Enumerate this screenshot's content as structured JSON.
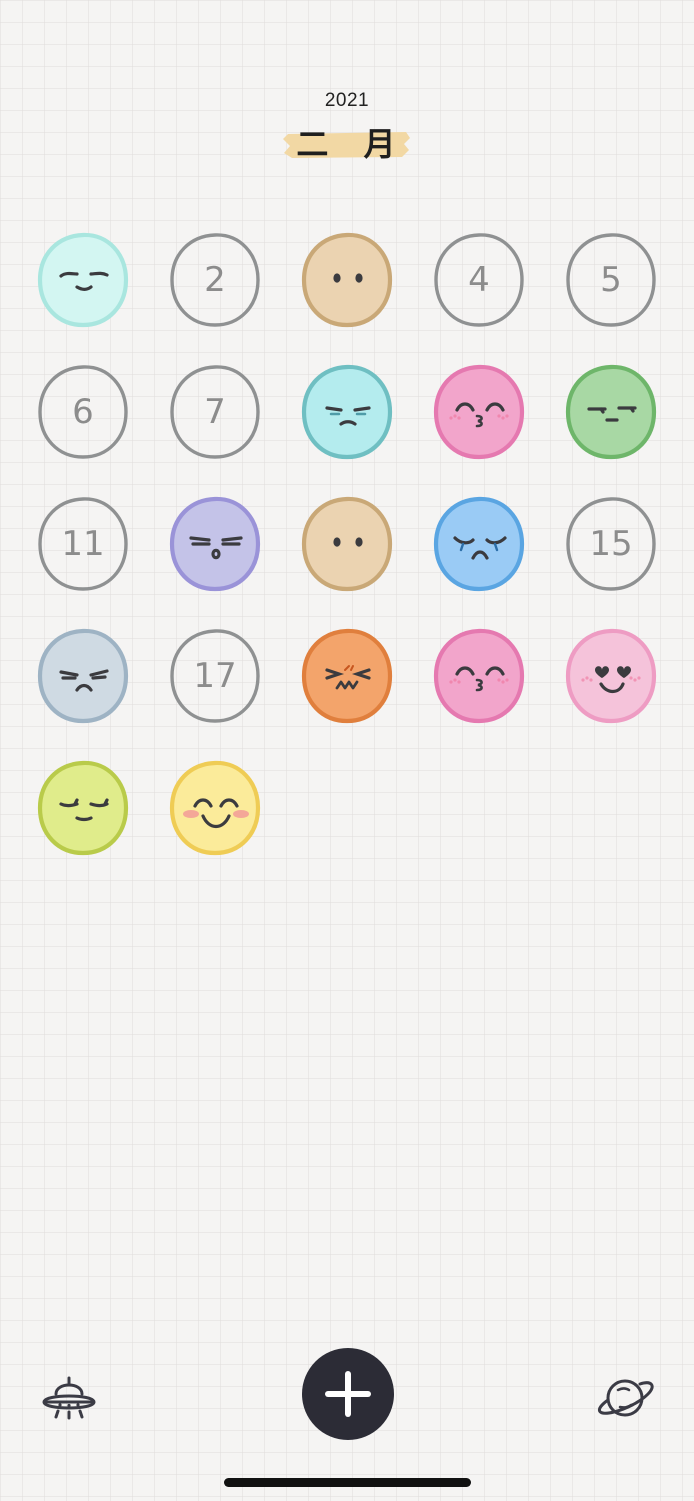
{
  "header": {
    "year": "2021",
    "month": "二 月"
  },
  "colors": {
    "tape": "#f2d8a4",
    "empty_border": "#8f9192",
    "add_button": "#2c2c36",
    "face_features": "#3b3b3f",
    "blush": "#ef6f98"
  },
  "days": [
    {
      "label": "",
      "mood": "content",
      "fill": "#d3f6f2",
      "stroke": "#a9e6df"
    },
    {
      "label": "2",
      "mood": "empty"
    },
    {
      "label": "",
      "mood": "neutral",
      "fill": "#ebd3b1",
      "stroke": "#c9a877"
    },
    {
      "label": "4",
      "mood": "empty"
    },
    {
      "label": "5",
      "mood": "empty"
    },
    {
      "label": "6",
      "mood": "empty"
    },
    {
      "label": "7",
      "mood": "empty"
    },
    {
      "label": "",
      "mood": "sad",
      "fill": "#b4ecee",
      "stroke": "#6fbfc2"
    },
    {
      "label": "",
      "mood": "kiss",
      "fill": "#f2a5cb",
      "stroke": "#e579b0"
    },
    {
      "label": "",
      "mood": "meh",
      "fill": "#a8d8a4",
      "stroke": "#6eb66a"
    },
    {
      "label": "11",
      "mood": "empty"
    },
    {
      "label": "",
      "mood": "tired",
      "fill": "#c4c3e8",
      "stroke": "#9a93d8"
    },
    {
      "label": "",
      "mood": "neutral",
      "fill": "#ebd3b1",
      "stroke": "#c9a877"
    },
    {
      "label": "",
      "mood": "crying",
      "fill": "#9acbf5",
      "stroke": "#5aa5e2"
    },
    {
      "label": "15",
      "mood": "empty"
    },
    {
      "label": "",
      "mood": "annoyed",
      "fill": "#cfdae3",
      "stroke": "#9eb3c4"
    },
    {
      "label": "17",
      "mood": "empty"
    },
    {
      "label": "",
      "mood": "angry",
      "fill": "#f3a46b",
      "stroke": "#e07f3d"
    },
    {
      "label": "",
      "mood": "kiss",
      "fill": "#f2a5cb",
      "stroke": "#e579b0"
    },
    {
      "label": "",
      "mood": "love",
      "fill": "#f5c3da",
      "stroke": "#ee9cc3"
    },
    {
      "label": "",
      "mood": "calm",
      "fill": "#e0ec8b",
      "stroke": "#b9cb4a"
    },
    {
      "label": "",
      "mood": "happy",
      "fill": "#fbeb9a",
      "stroke": "#efcc55"
    }
  ],
  "nav": {
    "left_icon": "ufo-icon",
    "center_icon": "plus-icon",
    "right_icon": "planet-icon"
  }
}
